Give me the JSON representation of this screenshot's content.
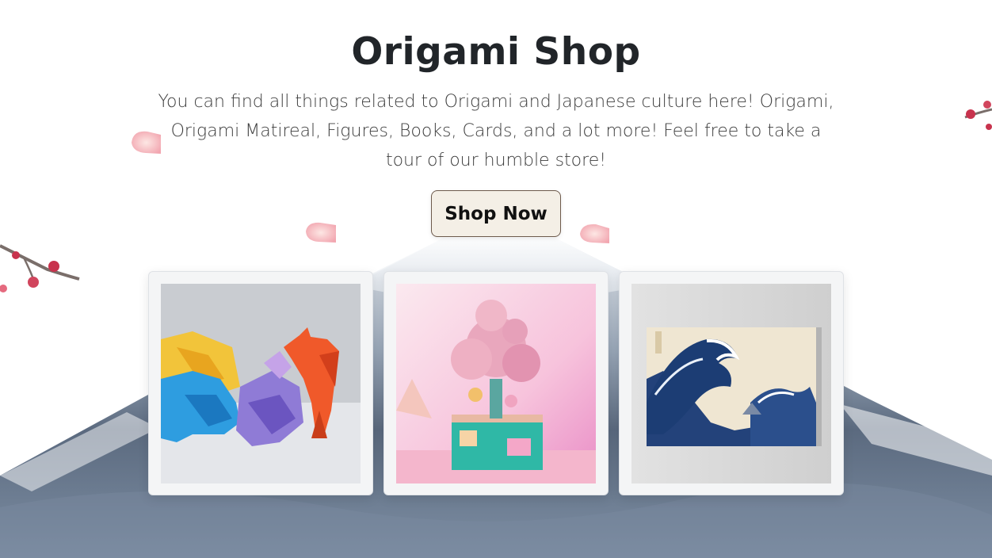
{
  "hero": {
    "title": "Origami Shop",
    "subtitle": "You can find all things related to Origami and Japanese culture here! Origami, Origami Matireal, Figures, Books, Cards, and a lot more! Feel free to take a tour of our humble store!",
    "cta_label": "Shop Now"
  },
  "products": [
    {
      "image": "origami-animals-image"
    },
    {
      "image": "cherry-blossom-music-box-image"
    },
    {
      "image": "great-wave-canvas-image"
    }
  ],
  "colors": {
    "button_bg": "#f4efe6",
    "button_border": "#6d5a4c",
    "mountain": "#5f6e82",
    "petal": "#f2b8bd",
    "blossom": "#c8334d"
  }
}
